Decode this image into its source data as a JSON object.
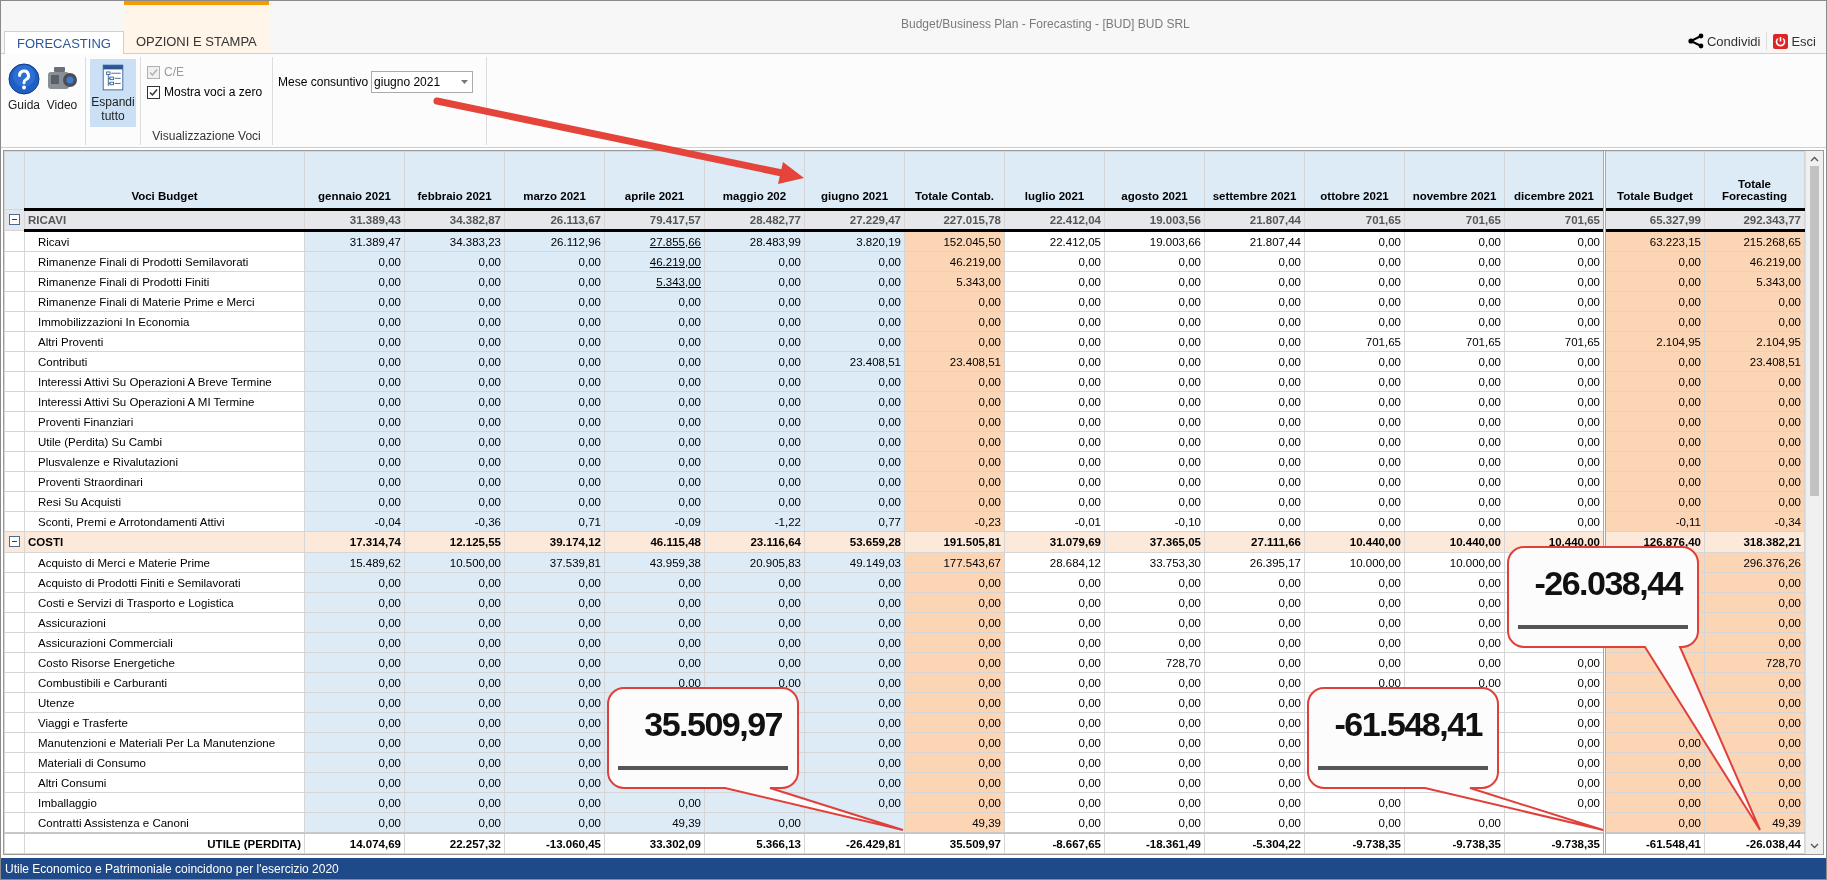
{
  "window": {
    "title": "Budget/Business Plan - Forecasting - [BUD] BUD SRL"
  },
  "ribbon": {
    "tabs": [
      {
        "label": "FORECASTING",
        "selected": true
      },
      {
        "label": "OPZIONI E STAMPA",
        "selected": false
      }
    ],
    "actions": [
      {
        "label": "Condividi",
        "kind": "share"
      },
      {
        "label": "Esci",
        "kind": "exit"
      }
    ],
    "buttons": [
      {
        "label": "Guida",
        "kind": "help",
        "selected": false
      },
      {
        "label": "Video",
        "kind": "video",
        "selected": false
      },
      {
        "label": "Espandi tutto",
        "kind": "expand",
        "selected": true
      }
    ],
    "checkboxes": [
      {
        "label": "C/E",
        "checked": true,
        "disabled": true
      },
      {
        "label": "Mostra voci a zero",
        "checked": true,
        "disabled": false
      }
    ],
    "group_label": "Visualizzazione Voci",
    "month_field": {
      "label": "Mese consuntivo",
      "value": "giugno 2021"
    }
  },
  "table": {
    "label_header": "Voci Budget",
    "columns": [
      {
        "label": "gennaio 2021",
        "kind": "actual"
      },
      {
        "label": "febbraio 2021",
        "kind": "actual"
      },
      {
        "label": "marzo 2021",
        "kind": "actual"
      },
      {
        "label": "aprile 2021",
        "kind": "actual"
      },
      {
        "label": "maggio 202",
        "kind": "actual"
      },
      {
        "label": "giugno 2021",
        "kind": "actual"
      },
      {
        "label": "Totale Contab.",
        "kind": "booked"
      },
      {
        "label": "luglio 2021",
        "kind": "forecast"
      },
      {
        "label": "agosto 2021",
        "kind": "forecast"
      },
      {
        "label": "settembre 2021",
        "kind": "forecast"
      },
      {
        "label": "ottobre 2021",
        "kind": "forecast"
      },
      {
        "label": "novembre 2021",
        "kind": "forecast"
      },
      {
        "label": "dicembre 2021",
        "kind": "forecast"
      },
      {
        "label": "Totale Budget",
        "kind": "total"
      },
      {
        "label": "Totale Forecasting",
        "kind": "total"
      }
    ],
    "groups": [
      {
        "name": "RICAVI",
        "kind": "revenue",
        "expanded": true,
        "totals": [
          "31.389,43",
          "34.382,87",
          "26.113,67",
          "79.417,57",
          "28.482,77",
          "27.229,47",
          "227.015,78",
          "22.412,04",
          "19.003,56",
          "21.807,44",
          "701,65",
          "701,65",
          "701,65",
          "65.327,99",
          "292.343,77"
        ],
        "rows": [
          {
            "name": "Ricavi",
            "values": [
              "31.389,47",
              "34.383,23",
              "26.112,96",
              {
                "text": "27.855,66",
                "linked": true
              },
              "28.483,99",
              "3.820,19",
              "152.045,50",
              "22.412,05",
              "19.003,66",
              "21.807,44",
              "0,00",
              "0,00",
              "0,00",
              "63.223,15",
              "215.268,65"
            ]
          },
          {
            "name": "Rimanenze Finali di Prodotti Semilavorati",
            "values": [
              "0,00",
              "0,00",
              "0,00",
              {
                "text": "46.219,00",
                "linked": true
              },
              "0,00",
              "0,00",
              "46.219,00",
              "0,00",
              "0,00",
              "0,00",
              "0,00",
              "0,00",
              "0,00",
              "0,00",
              "46.219,00"
            ]
          },
          {
            "name": "Rimanenze Finali di Prodotti Finiti",
            "values": [
              "0,00",
              "0,00",
              "0,00",
              {
                "text": "5.343,00",
                "linked": true
              },
              "0,00",
              "0,00",
              "5.343,00",
              "0,00",
              "0,00",
              "0,00",
              "0,00",
              "0,00",
              "0,00",
              "0,00",
              "5.343,00"
            ]
          },
          {
            "name": "Rimanenze Finali di Materie Prime e Merci",
            "values": [
              "0,00",
              "0,00",
              "0,00",
              "0,00",
              "0,00",
              "0,00",
              "0,00",
              "0,00",
              "0,00",
              "0,00",
              "0,00",
              "0,00",
              "0,00",
              "0,00",
              "0,00"
            ]
          },
          {
            "name": "Immobilizzazioni In Economia",
            "values": [
              "0,00",
              "0,00",
              "0,00",
              "0,00",
              "0,00",
              "0,00",
              "0,00",
              "0,00",
              "0,00",
              "0,00",
              "0,00",
              "0,00",
              "0,00",
              "0,00",
              "0,00"
            ]
          },
          {
            "name": "Altri Proventi",
            "values": [
              "0,00",
              "0,00",
              "0,00",
              "0,00",
              "0,00",
              "0,00",
              "0,00",
              "0,00",
              "0,00",
              "0,00",
              "701,65",
              "701,65",
              "701,65",
              "2.104,95",
              "2.104,95"
            ]
          },
          {
            "name": "Contributi",
            "values": [
              "0,00",
              "0,00",
              "0,00",
              "0,00",
              "0,00",
              "23.408,51",
              "23.408,51",
              "0,00",
              "0,00",
              "0,00",
              "0,00",
              "0,00",
              "0,00",
              "0,00",
              "23.408,51"
            ]
          },
          {
            "name": "Interessi Attivi Su Operazioni A Breve Termine",
            "values": [
              "0,00",
              "0,00",
              "0,00",
              "0,00",
              "0,00",
              "0,00",
              "0,00",
              "0,00",
              "0,00",
              "0,00",
              "0,00",
              "0,00",
              "0,00",
              "0,00",
              "0,00"
            ]
          },
          {
            "name": "Interessi Attivi Su Operazioni A MI Termine",
            "values": [
              "0,00",
              "0,00",
              "0,00",
              "0,00",
              "0,00",
              "0,00",
              "0,00",
              "0,00",
              "0,00",
              "0,00",
              "0,00",
              "0,00",
              "0,00",
              "0,00",
              "0,00"
            ]
          },
          {
            "name": "Proventi Finanziari",
            "values": [
              "0,00",
              "0,00",
              "0,00",
              "0,00",
              "0,00",
              "0,00",
              "0,00",
              "0,00",
              "0,00",
              "0,00",
              "0,00",
              "0,00",
              "0,00",
              "0,00",
              "0,00"
            ]
          },
          {
            "name": "Utile (Perdita) Su Cambi",
            "values": [
              "0,00",
              "0,00",
              "0,00",
              "0,00",
              "0,00",
              "0,00",
              "0,00",
              "0,00",
              "0,00",
              "0,00",
              "0,00",
              "0,00",
              "0,00",
              "0,00",
              "0,00"
            ]
          },
          {
            "name": "Plusvalenze e Rivalutazioni",
            "values": [
              "0,00",
              "0,00",
              "0,00",
              "0,00",
              "0,00",
              "0,00",
              "0,00",
              "0,00",
              "0,00",
              "0,00",
              "0,00",
              "0,00",
              "0,00",
              "0,00",
              "0,00"
            ]
          },
          {
            "name": "Proventi Straordinari",
            "values": [
              "0,00",
              "0,00",
              "0,00",
              "0,00",
              "0,00",
              "0,00",
              "0,00",
              "0,00",
              "0,00",
              "0,00",
              "0,00",
              "0,00",
              "0,00",
              "0,00",
              "0,00"
            ]
          },
          {
            "name": "Resi Su Acquisti",
            "values": [
              "0,00",
              "0,00",
              "0,00",
              "0,00",
              "0,00",
              "0,00",
              "0,00",
              "0,00",
              "0,00",
              "0,00",
              "0,00",
              "0,00",
              "0,00",
              "0,00",
              "0,00"
            ]
          },
          {
            "name": "Sconti, Premi e Arrotondamenti  Attivi",
            "values": [
              "-0,04",
              "-0,36",
              "0,71",
              "-0,09",
              "-1,22",
              "0,77",
              "-0,23",
              "-0,01",
              "-0,10",
              "0,00",
              "0,00",
              "0,00",
              "0,00",
              "-0,11",
              "-0,34"
            ]
          }
        ]
      },
      {
        "name": "COSTI",
        "kind": "cost",
        "expanded": true,
        "totals": [
          "17.314,74",
          "12.125,55",
          "39.174,12",
          "46.115,48",
          "23.116,64",
          "53.659,28",
          "191.505,81",
          "31.079,69",
          "37.365,05",
          "27.111,66",
          "10.440,00",
          "10.440,00",
          "10.440,00",
          "126.876,40",
          "318.382,21"
        ],
        "rows": [
          {
            "name": "Acquisto di Merci e Materie Prime",
            "values": [
              "15.489,62",
              "10.500,00",
              "37.539,81",
              "43.959,38",
              "20.905,83",
              "49.149,03",
              "177.543,67",
              "28.684,12",
              "33.753,30",
              "26.395,17",
              "10.000,00",
              "10.000,00",
              "296.376,26"
            ]
          },
          {
            "name": "Acquisto di Prodotti Finiti e Semilavorati",
            "values": [
              "0,00",
              "0,00",
              "0,00",
              "0,00",
              "0,00",
              "0,00",
              "0,00",
              "0,00",
              "0,00",
              "0,00",
              "0,00",
              "0,00",
              "0,00"
            ]
          },
          {
            "name": "Costi e Servizi di Trasporto e Logistica",
            "values": [
              "0,00",
              "0,00",
              "0,00",
              "0,00",
              "0,00",
              "0,00",
              "0,00",
              "0,00",
              "0,00",
              "0,00",
              "0,00",
              "0,00",
              "0,00"
            ]
          },
          {
            "name": "Assicurazioni",
            "values": [
              "0,00",
              "0,00",
              "0,00",
              "0,00",
              "0,00",
              "0,00",
              "0,00",
              "0,00",
              "0,00",
              "0,00",
              "0,00",
              "0,00",
              "0,00"
            ]
          },
          {
            "name": "Assicurazioni Commerciali",
            "values": [
              "0,00",
              "0,00",
              "0,00",
              "0,00",
              "0,00",
              "0,00",
              "0,00",
              "0,00",
              "0,00",
              "0,00",
              "0,00",
              "0,00",
              "0,00"
            ]
          },
          {
            "name": "Costo Risorse Energetiche",
            "values": [
              "0,00",
              "0,00",
              "0,00",
              "0,00",
              "0,00",
              "0,00",
              "0,00",
              "0,00",
              "728,70",
              "0,00",
              "0,00",
              "0,00",
              "0,00",
              "728,70"
            ]
          },
          {
            "name": "Combustibili e Carburanti",
            "values": [
              "0,00",
              "0,00",
              "0,00",
              "0,00",
              "0,00",
              "0,00",
              "0,00",
              "0,00",
              "0,00",
              "0,00",
              "0,00",
              "0,00",
              "0,00",
              "0,00"
            ]
          },
          {
            "name": "Utenze",
            "values": [
              "0,00",
              "0,00",
              "0,00",
              "0,00",
              "0,00",
              "0,00",
              "0,00",
              "0,00",
              "0,00",
              "0,00"
            ]
          },
          {
            "name": "Viaggi e Trasferte",
            "values": [
              "0,00",
              "0,00",
              "0,00",
              "0,00",
              "0,00",
              "0,00",
              "0,00",
              "0,00",
              "0,00",
              "0,00"
            ]
          },
          {
            "name": "Manutenzioni e Materiali Per La Manutenzione",
            "values": [
              "0,00",
              "0,00",
              "0,00",
              "0,00",
              "0,00",
              "0,00",
              "0,00",
              "0,00",
              "0,00",
              "0,00",
              "0,00"
            ]
          },
          {
            "name": "Materiali di Consumo",
            "values": [
              "0,00",
              "0,00",
              "0,00",
              "0,00",
              "0,00",
              "0,00",
              "0,00",
              "0,00",
              "0,00",
              "0,00",
              "0,00"
            ]
          },
          {
            "name": "Altri Consumi",
            "values": [
              "0,00",
              "0,00",
              "0,00",
              "0,00",
              "0,00",
              "0,00",
              "0,00",
              "0,00",
              "0,00",
              "0,00",
              "0,00"
            ]
          },
          {
            "name": "Imballaggio",
            "values": [
              "0,00",
              "0,00",
              "0,00",
              "0,00",
              "0,00",
              "0,00",
              "0,00",
              "0,00",
              "0,00",
              "0,00",
              "0,00",
              "0,00",
              "0,00"
            ]
          },
          {
            "name": "Contratti Assistenza e Canoni",
            "values": [
              "0,00",
              "0,00",
              "0,00",
              "49,39",
              "0,00",
              "49,39",
              "0,00",
              "0,00",
              "0,00",
              "0,00",
              "0,00",
              "0,00",
              "49,39"
            ]
          }
        ]
      }
    ],
    "result": {
      "label": "UTILE (PERDITA)",
      "values": [
        "14.074,69",
        "22.257,32",
        "-13.060,45",
        "33.302,09",
        "5.366,13",
        "-26.429,81",
        "35.509,97",
        "-8.667,65",
        "-18.361,49",
        "-5.304,22",
        "-9.738,35",
        "-9.738,35",
        "-9.738,35",
        "-61.548,41",
        "-26.038,44"
      ]
    }
  },
  "callouts": [
    {
      "text": "35.509,97"
    },
    {
      "text": "-61.548,41"
    },
    {
      "text": "-26.038,44"
    }
  ],
  "status_bar": {
    "text": "Utile Economico e Patrimoniale coincidono per l'esercizio 2020"
  }
}
